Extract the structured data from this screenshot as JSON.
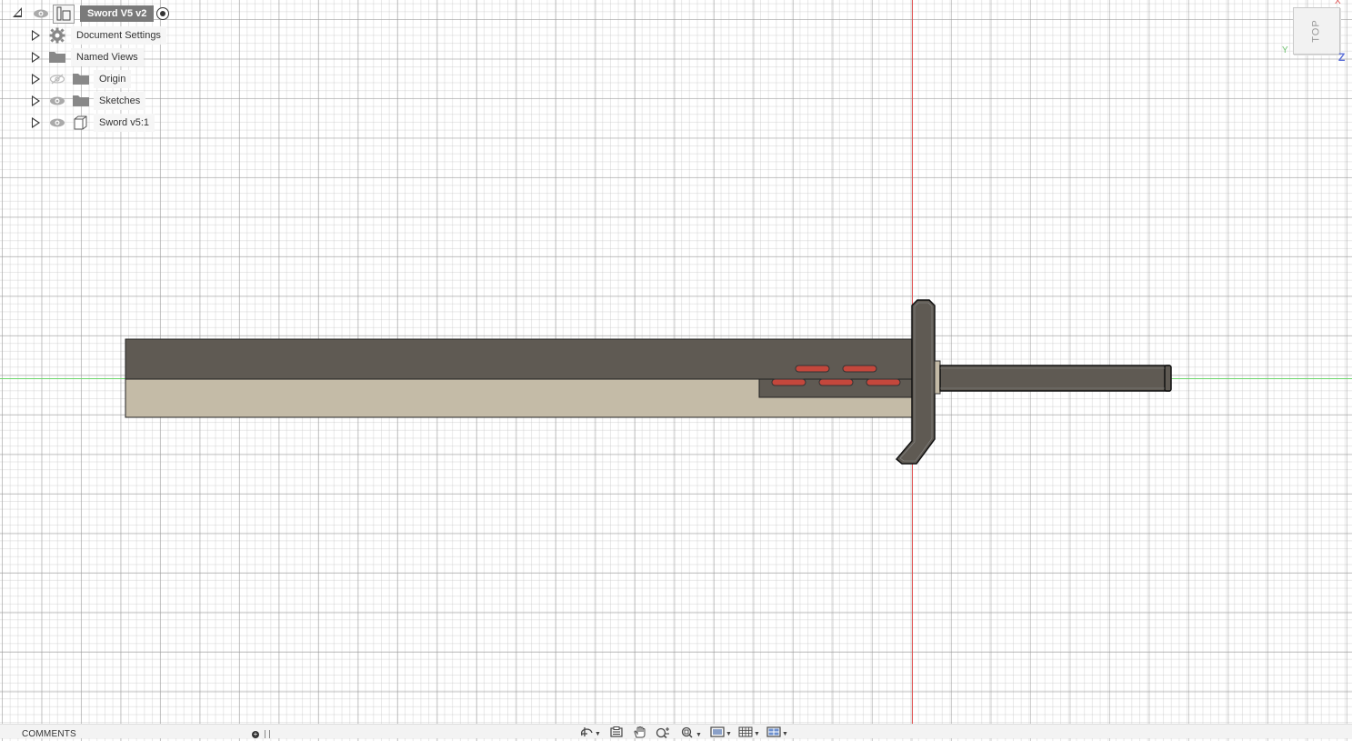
{
  "browser": {
    "root": {
      "label": "Sword V5 v2"
    },
    "items": [
      {
        "label": "Document Settings",
        "icon": "gear-icon"
      },
      {
        "label": "Named Views",
        "icon": "folder-icon"
      },
      {
        "label": "Origin",
        "icon": "folder-icon",
        "visibility": "hidden"
      },
      {
        "label": "Sketches",
        "icon": "folder-icon",
        "visibility": "visible"
      },
      {
        "label": "Sword v5:1",
        "icon": "component-icon",
        "visibility": "visible"
      }
    ]
  },
  "viewcube": {
    "face": "TOP",
    "x_label": "X",
    "y_label": "Y",
    "z_label": "Z"
  },
  "bottom_bar": {
    "comments_label": "COMMENTS",
    "tools": [
      "orbit-icon",
      "look-at-icon",
      "pan-icon",
      "zoom-icon",
      "fit-icon",
      "display-settings-icon",
      "grid-icon",
      "viewports-icon"
    ]
  },
  "colors": {
    "blade_dark": "#5f5a53",
    "blade_light": "#c4bba7",
    "guard": "#5f5a53",
    "slots": "#c4473c",
    "axis_x": "#e05050",
    "axis_y": "#6cd66c"
  }
}
